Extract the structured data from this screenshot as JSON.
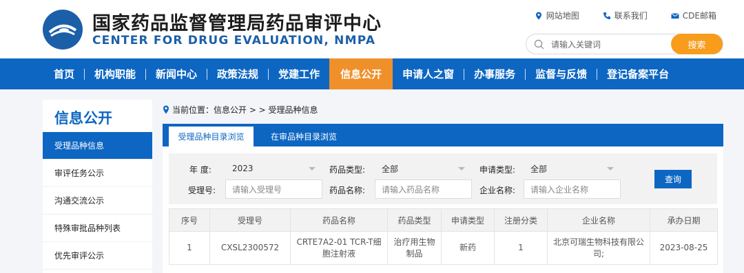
{
  "header": {
    "title_cn": "国家药品监督管理局药品审评中心",
    "title_en": "CENTER FOR DRUG EVALUATION, NMPA",
    "links": [
      {
        "label": "网站地图",
        "icon": "location-pin-icon"
      },
      {
        "label": "联系我们",
        "icon": "phone-icon"
      },
      {
        "label": "CDE邮箱",
        "icon": "mail-icon"
      }
    ],
    "search_placeholder": "请输入关键词",
    "search_button": "搜索"
  },
  "nav": {
    "items": [
      "首页",
      "机构职能",
      "新闻中心",
      "政策法规",
      "党建工作",
      "信息公开",
      "申请人之窗",
      "办事服务",
      "监督与反馈",
      "登记备案平台"
    ],
    "active_index": 5
  },
  "sidebar": {
    "title": "信息公开",
    "items": [
      "受理品种信息",
      "审评任务公示",
      "沟通交流公示",
      "特殊审批品种列表",
      "优先审评公示"
    ],
    "active_index": 0
  },
  "breadcrumb": {
    "text": "当前位置：信息公开 > > 受理品种信息"
  },
  "tabs": {
    "active": "受理品种目录浏览",
    "inactive": "在审品种目录浏览"
  },
  "filters": {
    "year_label": "年    度:",
    "year_value": "2023",
    "drug_type_label": "药品类型:",
    "drug_type_value": "全部",
    "apply_type_label": "申请类型:",
    "apply_type_value": "全部",
    "accept_no_label": "受理号:",
    "accept_no_placeholder": "请输入受理号",
    "drug_name_label": "药品名称:",
    "drug_name_placeholder": "请输入药品名称",
    "company_label": "企业名称:",
    "company_placeholder": "请输入企业名称",
    "query_button": "查询"
  },
  "table": {
    "headers": [
      "序号",
      "受理号",
      "药品名称",
      "药品类型",
      "申请类型",
      "注册分类",
      "企业名称",
      "承办日期"
    ],
    "rows": [
      [
        "1",
        "CXSL2300572",
        "CRTE7A2-01 TCR-T细胞注射液",
        "治疗用生物制品",
        "新药",
        "1",
        "北京可瑞生物科技有限公司;",
        "2023-08-25"
      ]
    ]
  },
  "colors": {
    "primary": "#0d66c2",
    "accent": "#f0902a"
  }
}
